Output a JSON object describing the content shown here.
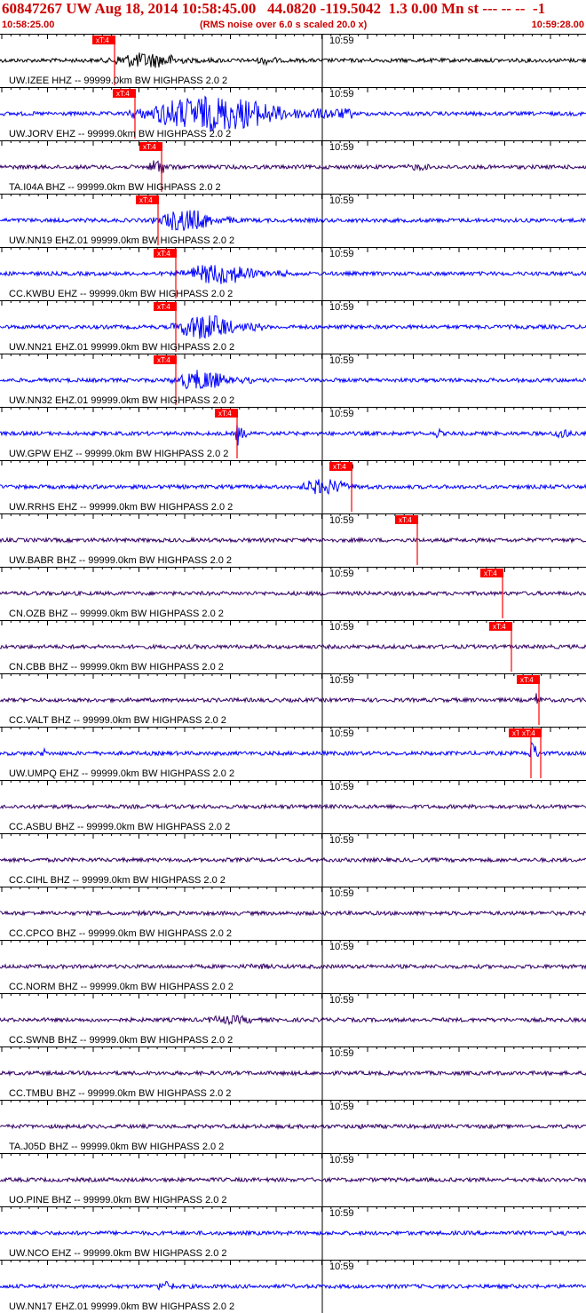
{
  "header": {
    "title": "60847267 UW Aug 18, 2014 10:58:45.00   44.0820 -119.5042  1.3 0.00 Mn st --- -- --  -1",
    "start_time": "10:58:25.00",
    "rms_note": "(RMS noise over 6.0 s scaled 20.0 x)",
    "end_time": "10:59:28.00"
  },
  "minute_label": "10:59",
  "pick_label": "xT:4",
  "colors": {
    "header_red": "#cc0000",
    "pick_red": "#ff0000",
    "blue": "#0000ff",
    "purple": "#330066",
    "black": "#000000",
    "tick": "#000000"
  },
  "traces": [
    {
      "label": "UW.IZEE HHZ -- 99999.0km BW  HIGHPASS  2.0  2",
      "color": "black",
      "picks": [
        0.195
      ],
      "bursts": [
        [
          0.17,
          0.38,
          9
        ],
        [
          0.43,
          0.5,
          5
        ]
      ]
    },
    {
      "label": "UW.JORV EHZ -- 99999.0km BW  HIGHPASS  2.0  2",
      "color": "blue",
      "picks": [
        0.23
      ],
      "bursts": [
        [
          0.22,
          0.6,
          20
        ]
      ]
    },
    {
      "label": "TA.I04A BHZ -- 99999.0km BW  HIGHPASS  2.0  2",
      "color": "purple",
      "picks": [
        0.275
      ],
      "bursts": [
        [
          0.25,
          0.3,
          10
        ],
        [
          0.68,
          0.77,
          4
        ]
      ]
    },
    {
      "label": "UW.NN19 EHZ.01 99999.0km BW  HIGHPASS  2.0  2",
      "color": "blue",
      "picks": [
        0.27
      ],
      "bursts": [
        [
          0.26,
          0.41,
          13
        ]
      ]
    },
    {
      "label": "CC.KWBU EHZ -- 99999.0km BW  HIGHPASS  2.0  2",
      "color": "blue",
      "picks": [
        0.3
      ],
      "bursts": [
        [
          0.3,
          0.5,
          12
        ]
      ]
    },
    {
      "label": "UW.NN21 EHZ.01 99999.0km BW  HIGHPASS  2.0  2",
      "color": "blue",
      "picks": [
        0.3
      ],
      "bursts": [
        [
          0.29,
          0.45,
          15
        ]
      ]
    },
    {
      "label": "UW.NN32 EHZ.01 99999.0km BW  HIGHPASS  2.0  2",
      "color": "blue",
      "picks": [
        0.3
      ],
      "bursts": [
        [
          0.29,
          0.43,
          12
        ]
      ]
    },
    {
      "label": "UW.GPW EHZ -- 99999.0km BW  HIGHPASS  2.0  2",
      "color": "blue",
      "picks": [
        0.405
      ],
      "bursts": [
        [
          0.4,
          0.42,
          14
        ],
        [
          0.74,
          0.76,
          6
        ],
        [
          0.94,
          0.99,
          7
        ]
      ]
    },
    {
      "label": "UW.RRHS EHZ -- 99999.0km BW  HIGHPASS  2.0  2",
      "color": "blue",
      "picks": [
        0.6
      ],
      "bursts": [
        [
          0.5,
          0.64,
          9
        ]
      ]
    },
    {
      "label": "UW.BABR BHZ -- 99999.0km BW  HIGHPASS  2.0  2",
      "color": "purple",
      "picks": [
        0.712
      ],
      "bursts": []
    },
    {
      "label": "CN.OZB BHZ -- 99999.0km BW  HIGHPASS  2.0  2",
      "color": "purple",
      "picks": [
        0.858
      ],
      "bursts": []
    },
    {
      "label": "CN.CBB BHZ -- 99999.0km BW  HIGHPASS  2.0  2",
      "color": "purple",
      "picks": [
        0.873
      ],
      "bursts": []
    },
    {
      "label": "CC.VALT BHZ -- 99999.0km BW  HIGHPASS  2.0  2",
      "color": "purple",
      "picks": [
        0.92
      ],
      "bursts": [
        [
          0.91,
          0.93,
          9
        ]
      ]
    },
    {
      "label": "UW.UMPQ EHZ -- 99999.0km BW  HIGHPASS  2.0  2",
      "color": "blue",
      "picks": [
        0.906,
        0.922
      ],
      "bursts": [
        [
          0.07,
          0.08,
          9
        ],
        [
          0.9,
          0.925,
          14
        ]
      ]
    },
    {
      "label": "CC.ASBU BHZ -- 99999.0km BW  HIGHPASS  2.0  2",
      "color": "purple",
      "picks": [],
      "bursts": []
    },
    {
      "label": "CC.CIHL BHZ -- 99999.0km BW  HIGHPASS  2.0  2",
      "color": "purple",
      "picks": [],
      "bursts": []
    },
    {
      "label": "CC.CPCO BHZ -- 99999.0km BW  HIGHPASS  2.0  2",
      "color": "purple",
      "picks": [],
      "bursts": [
        [
          0.22,
          0.3,
          3
        ]
      ]
    },
    {
      "label": "CC.NORM BHZ -- 99999.0km BW  HIGHPASS  2.0  2",
      "color": "purple",
      "picks": [],
      "bursts": [
        [
          0.38,
          0.55,
          3
        ]
      ]
    },
    {
      "label": "CC.SWNB BHZ -- 99999.0km BW  HIGHPASS  2.0  2",
      "color": "purple",
      "picks": [],
      "bursts": [
        [
          0.33,
          0.5,
          5
        ]
      ]
    },
    {
      "label": "CC.TMBU BHZ -- 99999.0km BW  HIGHPASS  2.0  2",
      "color": "purple",
      "picks": [],
      "bursts": []
    },
    {
      "label": "TA.J05D BHZ -- 99999.0km BW  HIGHPASS  2.0  2",
      "color": "purple",
      "picks": [],
      "bursts": [
        [
          0.58,
          0.7,
          3
        ]
      ]
    },
    {
      "label": "UO.PINE BHZ -- 99999.0km BW  HIGHPASS  2.0  2",
      "color": "purple",
      "picks": [],
      "bursts": []
    },
    {
      "label": "UW.NCO EHZ -- 99999.0km BW  HIGHPASS  2.0  2",
      "color": "blue",
      "picks": [],
      "bursts": []
    },
    {
      "label": "UW.NN17 EHZ.01 99999.0km BW  HIGHPASS  2.0  2",
      "color": "blue",
      "picks": [],
      "bursts": [
        [
          0.26,
          0.32,
          6
        ]
      ]
    }
  ]
}
